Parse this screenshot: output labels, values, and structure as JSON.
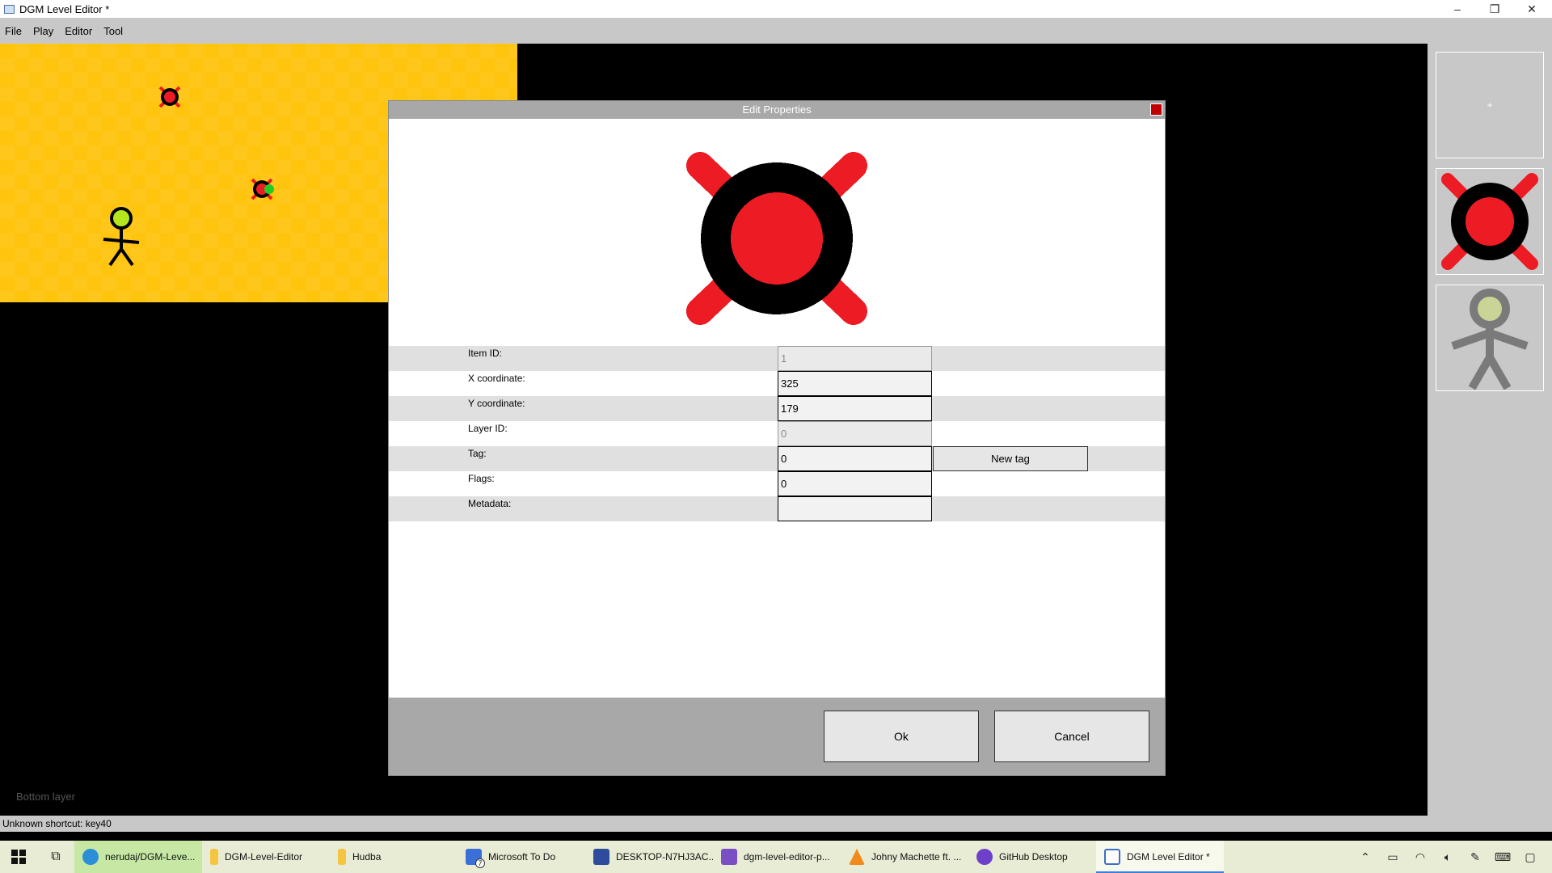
{
  "window": {
    "title": "DGM Level Editor *",
    "controls": {
      "minimize": "–",
      "maximize": "❐",
      "close": "✕"
    }
  },
  "menu": [
    "File",
    "Play",
    "Editor",
    "Tool"
  ],
  "canvas": {
    "layer_label": "Bottom layer",
    "level_color": "#ffc40e",
    "objects": [
      "mine",
      "mine-selected",
      "person"
    ]
  },
  "palette": {
    "add_label": "+",
    "items": [
      "mine-icon",
      "person-icon"
    ]
  },
  "status": "Unknown shortcut: key40",
  "dialog": {
    "title": "Edit Properties",
    "rows": [
      {
        "label": "Item ID:",
        "value": "1",
        "readonly": true
      },
      {
        "label": "X coordinate:",
        "value": "325",
        "readonly": false
      },
      {
        "label": "Y coordinate:",
        "value": "179",
        "readonly": false
      },
      {
        "label": "Layer ID:",
        "value": "0",
        "readonly": true
      },
      {
        "label": "Tag:",
        "value": "0",
        "readonly": false
      },
      {
        "label": "Flags:",
        "value": "0",
        "readonly": false
      },
      {
        "label": "Metadata:",
        "value": "",
        "readonly": false
      }
    ],
    "new_tag_label": "New tag",
    "ok_label": "Ok",
    "cancel_label": "Cancel"
  },
  "taskbar": {
    "tasks": [
      {
        "label": "nerudaj/DGM-Leve...",
        "icon": "edge-icon",
        "color": "#2a8fd6"
      },
      {
        "label": "DGM-Level-Editor",
        "icon": "folder-icon",
        "color": "#f5c542"
      },
      {
        "label": "Hudba",
        "icon": "folder-icon",
        "color": "#f5c542"
      },
      {
        "label": "Microsoft To Do",
        "icon": "todo-icon",
        "color": "#3a6fd8"
      },
      {
        "label": "DESKTOP-N7HJ3AC...",
        "icon": "remote-desktop-icon",
        "color": "#2d4d9c"
      },
      {
        "label": "dgm-level-editor-p...",
        "icon": "visual-studio-icon",
        "color": "#7a4fc4"
      },
      {
        "label": "Johny Machette ft. ...",
        "icon": "vlc-icon",
        "color": "#f08a1c"
      },
      {
        "label": "GitHub Desktop",
        "icon": "github-icon",
        "color": "#6e40c9"
      },
      {
        "label": "DGM Level Editor *",
        "icon": "app-window-icon",
        "color": "#3c6ec4"
      }
    ],
    "todo_badge": "7"
  },
  "colors": {
    "mine_red": "#ed1c24",
    "mine_black": "#000000",
    "person_head": "#b5e61d"
  }
}
